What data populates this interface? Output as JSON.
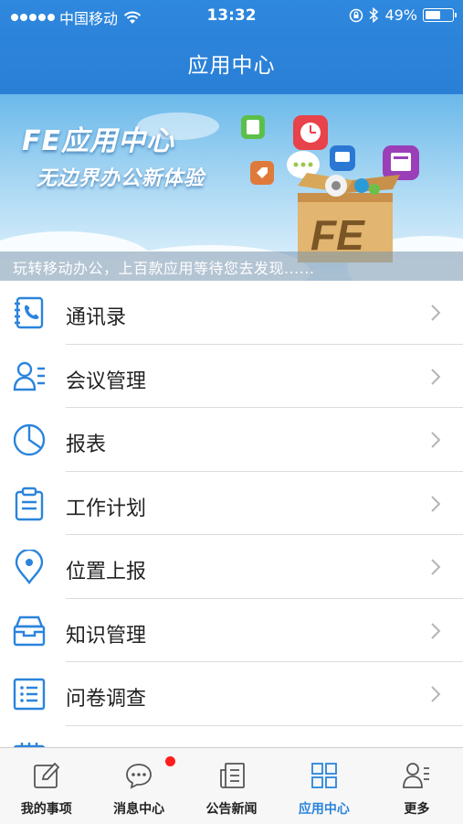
{
  "status_bar": {
    "carrier": "中国移动",
    "time": "13:32",
    "battery": "49%"
  },
  "nav": {
    "title": "应用中心"
  },
  "banner": {
    "title": "FE应用中心",
    "subtitle": "无边界办公新体验",
    "caption": "玩转移动办公，上百款应用等待您去发现......",
    "box_logo": "FE"
  },
  "menu": {
    "items": [
      {
        "label": "通讯录",
        "icon": "contacts-icon"
      },
      {
        "label": "会议管理",
        "icon": "meeting-icon"
      },
      {
        "label": "报表",
        "icon": "pie-chart-icon"
      },
      {
        "label": "工作计划",
        "icon": "clipboard-icon"
      },
      {
        "label": "位置上报",
        "icon": "location-pin-icon"
      },
      {
        "label": "知识管理",
        "icon": "inbox-icon"
      },
      {
        "label": "问卷调查",
        "icon": "list-icon"
      }
    ]
  },
  "tabs": [
    {
      "label": "我的事项",
      "icon": "edit-icon",
      "active": false
    },
    {
      "label": "消息中心",
      "icon": "chat-bubble-icon",
      "active": false,
      "badge": true
    },
    {
      "label": "公告新闻",
      "icon": "news-icon",
      "active": false
    },
    {
      "label": "应用中心",
      "icon": "grid-icon",
      "active": true
    },
    {
      "label": "更多",
      "icon": "more-icon",
      "active": false
    }
  ],
  "colors": {
    "primary": "#2a84dc",
    "badge": "#ff1d1d"
  }
}
